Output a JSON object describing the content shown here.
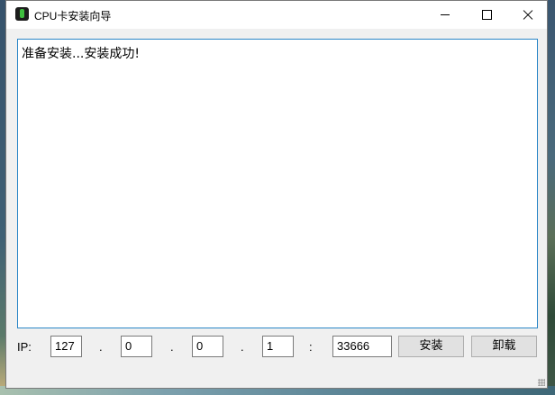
{
  "window": {
    "title": "CPU卡安装向导",
    "controls": {
      "minimize": "minimize",
      "maximize": "maximize",
      "close": "close"
    }
  },
  "log": {
    "text": "准备安装...安装成功!"
  },
  "connection": {
    "ip_label": "IP:",
    "ip_octets": [
      "127",
      "0",
      "0",
      "1"
    ],
    "dot": ".",
    "colon": ":",
    "port": "33666"
  },
  "actions": {
    "install_label": "安装",
    "uninstall_label": "卸载"
  }
}
